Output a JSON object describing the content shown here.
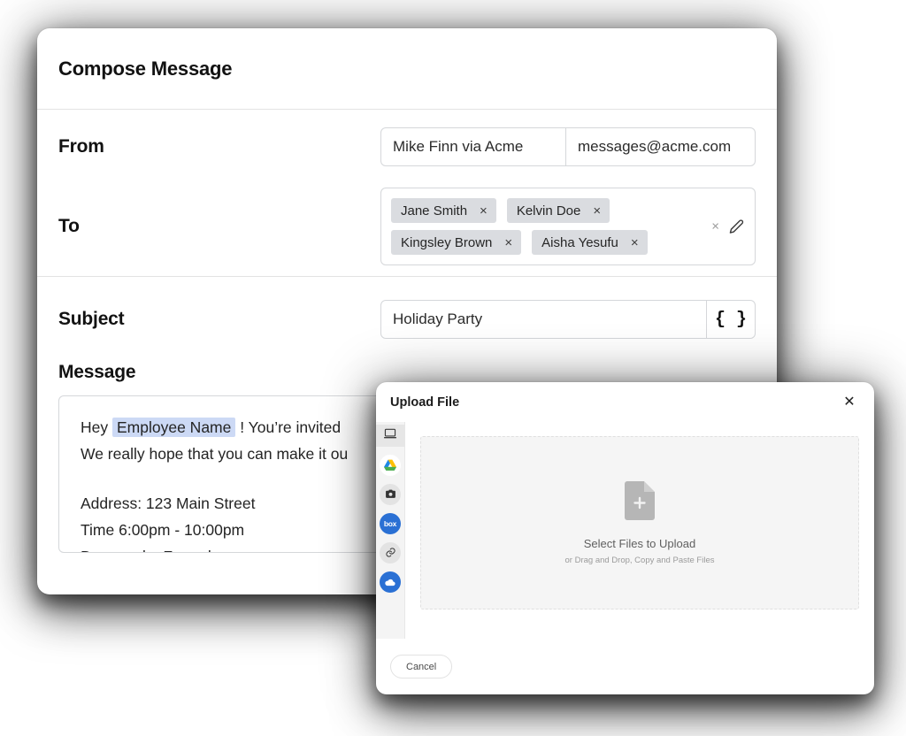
{
  "compose": {
    "title": "Compose Message",
    "from": {
      "label": "From",
      "name": "Mike Finn via Acme",
      "email": "messages@acme.com"
    },
    "to": {
      "label": "To",
      "chips": [
        {
          "name": "Jane Smith",
          "remove": "×"
        },
        {
          "name": "Kelvin Doe",
          "remove": "×"
        },
        {
          "name": "Kingsley Brown",
          "remove": "×"
        },
        {
          "name": "Aisha Yesufu",
          "remove": "×"
        }
      ],
      "clear_all": "×",
      "edit_icon": "pencil-icon"
    },
    "subject": {
      "label": "Subject",
      "value": "Holiday Party",
      "merge_tag_button": "{ }"
    },
    "message": {
      "label": "Message",
      "line1_before": "Hey",
      "merge_tag": "Employee Name",
      "line1_after": "!  You’re invited",
      "line2": "We really hope that you can make it ou",
      "line3": "Address: 123 Main Street",
      "line4": "Time 6:00pm - 10:00pm",
      "line5": "Dresscode: Formal"
    }
  },
  "upload_dialog": {
    "title": "Upload File",
    "close_label": "✕",
    "sources": [
      {
        "id": "my-device",
        "icon": "monitor-icon",
        "active": true
      },
      {
        "id": "google-drive",
        "icon": "google-drive-icon",
        "active": false
      },
      {
        "id": "camera",
        "icon": "camera-icon",
        "active": false
      },
      {
        "id": "box",
        "icon": "box-icon",
        "label": "box",
        "active": false
      },
      {
        "id": "link",
        "icon": "link-icon",
        "active": false
      },
      {
        "id": "onedrive",
        "icon": "onedrive-cloud-icon",
        "active": false
      }
    ],
    "dropzone": {
      "icon": "file-plus-icon",
      "title": "Select Files to Upload",
      "subtitle": "or Drag and Drop, Copy and Paste Files"
    },
    "cancel_label": "Cancel"
  },
  "colors": {
    "chip_bg": "#dadce0",
    "merge_highlight": "#ccd9f5",
    "accent_blue": "#2a70d4",
    "dropzone_bg": "#f5f5f5"
  }
}
